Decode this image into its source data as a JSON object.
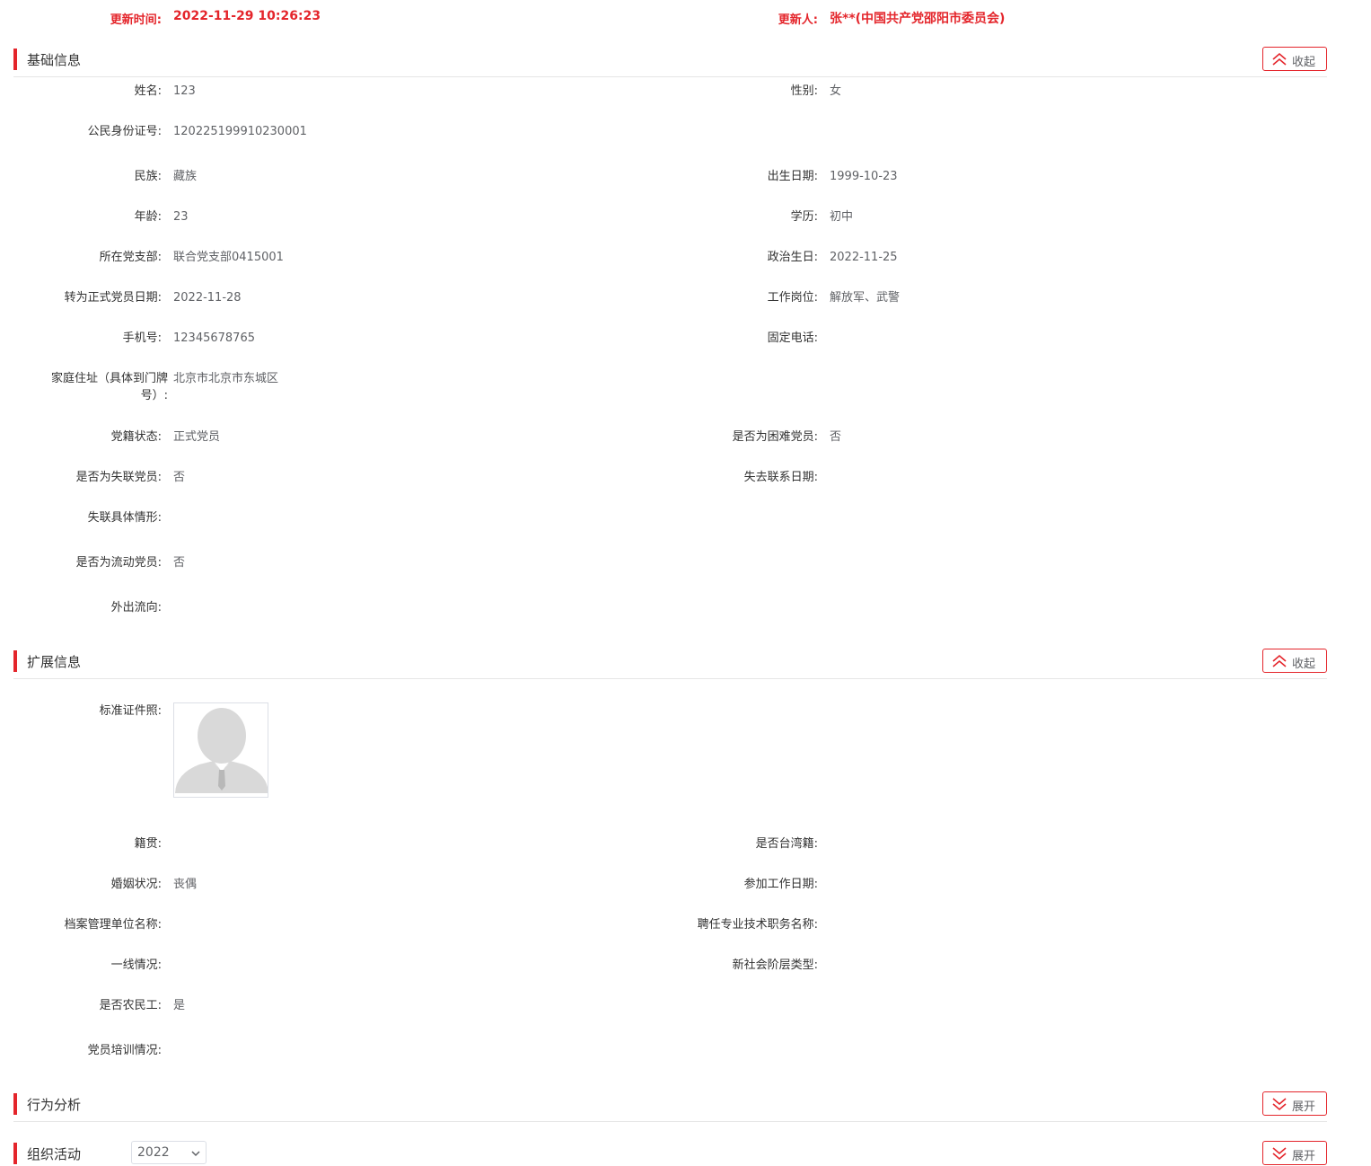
{
  "update": {
    "time_label": "更新时间:",
    "time_value": "2022-11-29 10:26:23",
    "user_label": "更新人:",
    "user_value": "张**(中国共产党邵阳市委员会)"
  },
  "sections": {
    "basic": {
      "title": "基础信息",
      "toggle": "收起"
    },
    "extended": {
      "title": "扩展信息",
      "toggle": "收起"
    },
    "behavior": {
      "title": "行为分析",
      "toggle": "展开"
    },
    "org_activity": {
      "title": "组织活动",
      "toggle": "展开",
      "year_selected": "2022"
    }
  },
  "basic": {
    "name": {
      "label": "姓名:",
      "value": "123"
    },
    "gender": {
      "label": "性别:",
      "value": "女"
    },
    "id_number": {
      "label": "公民身份证号:",
      "value": "120225199910230001"
    },
    "ethnicity": {
      "label": "民族:",
      "value": "藏族"
    },
    "birth_date": {
      "label": "出生日期:",
      "value": "1999-10-23"
    },
    "age": {
      "label": "年龄:",
      "value": "23"
    },
    "education": {
      "label": "学历:",
      "value": "初中"
    },
    "branch": {
      "label": "所在党支部:",
      "value": "联合党支部0415001"
    },
    "political_birthday": {
      "label": "政治生日:",
      "value": "2022-11-25"
    },
    "full_member_date": {
      "label": "转为正式党员日期:",
      "value": "2022-11-28"
    },
    "job_position": {
      "label": "工作岗位:",
      "value": "解放军、武警"
    },
    "mobile": {
      "label": "手机号:",
      "value": "12345678765"
    },
    "landline": {
      "label": "固定电话:",
      "value": ""
    },
    "home_address": {
      "label": "家庭住址（具体到门牌号）:",
      "value": "北京市北京市东城区"
    },
    "membership_status": {
      "label": "党籍状态:",
      "value": "正式党员"
    },
    "is_needy": {
      "label": "是否为困难党员:",
      "value": "否"
    },
    "is_lost_contact": {
      "label": "是否为失联党员:",
      "value": "否"
    },
    "lost_contact_date": {
      "label": "失去联系日期:",
      "value": ""
    },
    "lost_contact_details": {
      "label": "失联具体情形:",
      "value": ""
    },
    "is_mobile_member": {
      "label": "是否为流动党员:",
      "value": "否"
    },
    "outflow_direction": {
      "label": "外出流向:",
      "value": ""
    }
  },
  "extended": {
    "photo": {
      "label": "标准证件照:"
    },
    "native_place": {
      "label": "籍贯:",
      "value": ""
    },
    "is_taiwan": {
      "label": "是否台湾籍:",
      "value": ""
    },
    "marital_status": {
      "label": "婚姻状况:",
      "value": "丧偶"
    },
    "work_start_date": {
      "label": "参加工作日期:",
      "value": ""
    },
    "archive_unit": {
      "label": "档案管理单位名称:",
      "value": ""
    },
    "professional_title": {
      "label": "聘任专业技术职务名称:",
      "value": ""
    },
    "frontline": {
      "label": "一线情况:",
      "value": ""
    },
    "new_social_class": {
      "label": "新社会阶层类型:",
      "value": ""
    },
    "is_migrant_worker": {
      "label": "是否农民工:",
      "value": "是"
    },
    "training": {
      "label": "党员培训情况:",
      "value": ""
    }
  },
  "colors": {
    "accent": "#e4252b",
    "label": "#333333",
    "value": "#606266",
    "divider": "#e6e6e6"
  },
  "icons": {
    "collapse": "double-chevron-up-icon",
    "expand": "double-chevron-down-icon"
  }
}
